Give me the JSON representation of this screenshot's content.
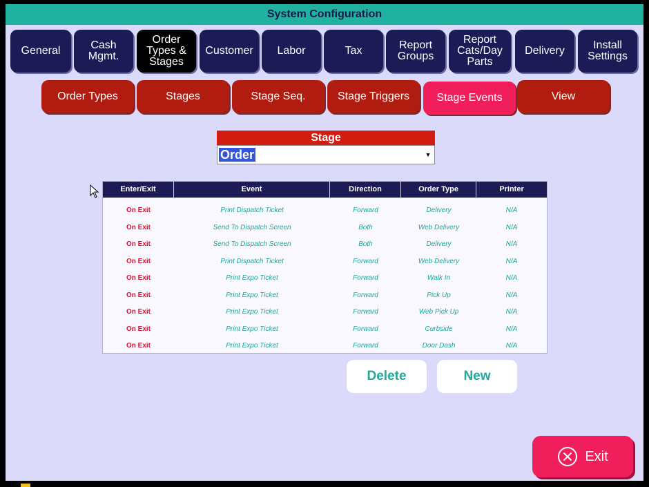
{
  "window": {
    "title": "System Configuration"
  },
  "tabs": [
    {
      "label": "General"
    },
    {
      "label": "Cash\nMgmt."
    },
    {
      "label": "Order\nTypes &\nStages",
      "active": true
    },
    {
      "label": "Customer"
    },
    {
      "label": "Labor"
    },
    {
      "label": "Tax"
    },
    {
      "label": "Report\nGroups"
    },
    {
      "label": "Report\nCats/Day\nParts"
    },
    {
      "label": "Delivery"
    },
    {
      "label": "Install\nSettings"
    }
  ],
  "subtabs": [
    {
      "label": "Order Types"
    },
    {
      "label": "Stages"
    },
    {
      "label": "Stage Seq."
    },
    {
      "label": "Stage Triggers"
    },
    {
      "label": "Stage Events",
      "active": true
    },
    {
      "label": "View"
    }
  ],
  "stage": {
    "label": "Stage",
    "value": "Order"
  },
  "grid": {
    "headers": [
      "Enter/Exit",
      "Event",
      "Direction",
      "Order Type",
      "Printer"
    ],
    "rows": [
      [
        "On Exit",
        "Print Dispatch Ticket",
        "Forward",
        "Delivery",
        "N/A"
      ],
      [
        "On Exit",
        "Send To Dispatch Screen",
        "Both",
        "Web Delivery",
        "N/A"
      ],
      [
        "On Exit",
        "Send To Dispatch Screen",
        "Both",
        "Delivery",
        "N/A"
      ],
      [
        "On Exit",
        "Print Dispatch Ticket",
        "Forward",
        "Web Delivery",
        "N/A"
      ],
      [
        "On Exit",
        "Print Expo Ticket",
        "Forward",
        "Walk In",
        "N/A"
      ],
      [
        "On Exit",
        "Print Expo Ticket",
        "Forward",
        "Pick Up",
        "N/A"
      ],
      [
        "On Exit",
        "Print Expo Ticket",
        "Forward",
        "Web Pick Up",
        "N/A"
      ],
      [
        "On Exit",
        "Print Expo Ticket",
        "Forward",
        "Curbside",
        "N/A"
      ],
      [
        "On Exit",
        "Print Expo Ticket",
        "Forward",
        "Door Dash",
        "N/A"
      ]
    ]
  },
  "actions": {
    "delete_label": "Delete",
    "new_label": "New",
    "exit_label": "Exit"
  },
  "colors": {
    "background": "#dcdafa",
    "titlebar": "#20b2a0",
    "tab": "#1c1b55",
    "subtab": "#b01c10",
    "subtab_active": "#f01e5a",
    "exit": "#f01e5a",
    "accent_text": "#1aa89a"
  }
}
